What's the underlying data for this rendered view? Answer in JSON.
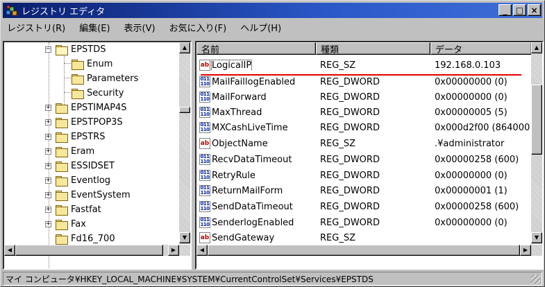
{
  "window": {
    "title": "レジストリ エディタ",
    "controls": {
      "minimize": "_",
      "maximize": "□",
      "close": "×"
    }
  },
  "menu": [
    "レジストリ(R)",
    "編集(E)",
    "表示(V)",
    "お気に入り(F)",
    "ヘルプ(H)"
  ],
  "tree": {
    "items": [
      {
        "label": "EPSTDS",
        "expander": "−",
        "open": true
      },
      {
        "label": "Enum",
        "child": true
      },
      {
        "label": "Parameters",
        "child": true
      },
      {
        "label": "Security",
        "child": true
      },
      {
        "label": "EPSTIMAP4S",
        "expander": "+"
      },
      {
        "label": "EPSTPOP3S",
        "expander": "+"
      },
      {
        "label": "EPSTRS",
        "expander": "+"
      },
      {
        "label": "Eram",
        "expander": "+"
      },
      {
        "label": "ESSIDSET",
        "expander": "+"
      },
      {
        "label": "Eventlog",
        "expander": "+"
      },
      {
        "label": "EventSystem",
        "expander": "+"
      },
      {
        "label": "Fastfat",
        "expander": "+"
      },
      {
        "label": "Fax",
        "expander": "+"
      },
      {
        "label": "Fd16_700",
        "expander": ""
      }
    ]
  },
  "list": {
    "columns": [
      "名前",
      "種類",
      "データ"
    ],
    "rows": [
      {
        "icon": "ab",
        "name": "LogicalIP",
        "type": "REG_SZ",
        "data": "192.168.0.103",
        "selected": true
      },
      {
        "icon": "bin",
        "name": "MailFaillogEnabled",
        "type": "REG_DWORD",
        "data": "0x00000000 (0)"
      },
      {
        "icon": "bin",
        "name": "MailForward",
        "type": "REG_DWORD",
        "data": "0x00000000 (0)"
      },
      {
        "icon": "bin",
        "name": "MaxThread",
        "type": "REG_DWORD",
        "data": "0x00000005 (5)"
      },
      {
        "icon": "bin",
        "name": "MXCashLiveTime",
        "type": "REG_DWORD",
        "data": "0x000d2f00 (864000"
      },
      {
        "icon": "ab",
        "name": "ObjectName",
        "type": "REG_SZ",
        "data": ".¥administrator"
      },
      {
        "icon": "bin",
        "name": "RecvDataTimeout",
        "type": "REG_DWORD",
        "data": "0x00000258 (600)"
      },
      {
        "icon": "bin",
        "name": "RetryRule",
        "type": "REG_DWORD",
        "data": "0x00000000 (0)"
      },
      {
        "icon": "bin",
        "name": "ReturnMailForm",
        "type": "REG_DWORD",
        "data": "0x00000001 (1)"
      },
      {
        "icon": "bin",
        "name": "SendDataTimeout",
        "type": "REG_DWORD",
        "data": "0x00000258 (600)"
      },
      {
        "icon": "bin",
        "name": "SenderlogEnabled",
        "type": "REG_DWORD",
        "data": "0x00000000 (0)"
      },
      {
        "icon": "ab",
        "name": "SendGateway",
        "type": "REG_SZ",
        "data": ""
      }
    ]
  },
  "icons": {
    "string_value": "ab",
    "binary_value": "011\n110"
  },
  "status": "マイ コンピュータ¥HKEY_LOCAL_MACHINE¥SYSTEM¥CurrentControlSet¥Services¥EPSTDS",
  "colors": {
    "title_start": "#0a1e6e",
    "title_end": "#3f6fd8",
    "annotation": "#e00000"
  }
}
